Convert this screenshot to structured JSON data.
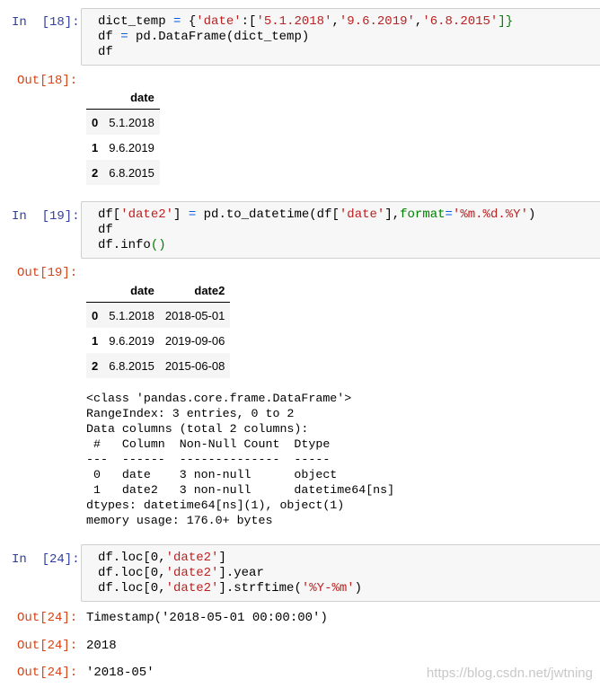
{
  "cells": [
    {
      "in_prompt": "In  [18]:",
      "out_prompt": "Out[18]:",
      "code": [
        [
          {
            "t": "dict_temp ",
            "c": ""
          },
          {
            "t": "=",
            "c": "o"
          },
          {
            "t": " {",
            "c": ""
          },
          {
            "t": "'date'",
            "c": "s"
          },
          {
            "t": ":[",
            "c": ""
          },
          {
            "t": "'5.1.2018'",
            "c": "s"
          },
          {
            "t": ",",
            "c": ""
          },
          {
            "t": "'9.6.2019'",
            "c": "s"
          },
          {
            "t": ",",
            "c": ""
          },
          {
            "t": "'6.8.2015'",
            "c": "s"
          },
          {
            "t": "]}",
            "c": "g"
          }
        ],
        [
          {
            "t": "df ",
            "c": ""
          },
          {
            "t": "=",
            "c": "o"
          },
          {
            "t": " pd.DataFrame(dict_temp)",
            "c": ""
          }
        ],
        [
          {
            "t": "df",
            "c": ""
          }
        ]
      ],
      "table": {
        "columns": [
          "date"
        ],
        "rows": [
          {
            "index": "0",
            "values": [
              "5.1.2018"
            ]
          },
          {
            "index": "1",
            "values": [
              "9.6.2019"
            ]
          },
          {
            "index": "2",
            "values": [
              "6.8.2015"
            ]
          }
        ]
      }
    },
    {
      "in_prompt": "In  [19]:",
      "out_prompt": "Out[19]:",
      "code": [
        [
          {
            "t": "df[",
            "c": ""
          },
          {
            "t": "'date2'",
            "c": "s"
          },
          {
            "t": "] ",
            "c": ""
          },
          {
            "t": "=",
            "c": "o"
          },
          {
            "t": " pd.to_datetime(df[",
            "c": ""
          },
          {
            "t": "'date'",
            "c": "s"
          },
          {
            "t": "],",
            "c": ""
          },
          {
            "t": "format",
            "c": "k"
          },
          {
            "t": "=",
            "c": "o"
          },
          {
            "t": "'%m.%d.%Y'",
            "c": "s"
          },
          {
            "t": ")",
            "c": ""
          }
        ],
        [
          {
            "t": "df",
            "c": ""
          }
        ],
        [
          {
            "t": "df.info",
            "c": ""
          },
          {
            "t": "()",
            "c": "g"
          }
        ]
      ],
      "table": {
        "columns": [
          "date",
          "date2"
        ],
        "rows": [
          {
            "index": "0",
            "values": [
              "5.1.2018",
              "2018-05-01"
            ]
          },
          {
            "index": "1",
            "values": [
              "9.6.2019",
              "2019-09-06"
            ]
          },
          {
            "index": "2",
            "values": [
              "6.8.2015",
              "2015-06-08"
            ]
          }
        ]
      },
      "info_lines": [
        "<class 'pandas.core.frame.DataFrame'>",
        "RangeIndex: 3 entries, 0 to 2",
        "Data columns (total 2 columns):",
        " #   Column  Non-Null Count  Dtype",
        "---  ------  --------------  -----",
        " 0   date    3 non-null      object",
        " 1   date2   3 non-null      datetime64[ns]",
        "dtypes: datetime64[ns](1), object(1)",
        "memory usage: 176.0+ bytes"
      ]
    },
    {
      "in_prompt": "In  [24]:",
      "code": [
        [
          {
            "t": "df.loc[0,",
            "c": ""
          },
          {
            "t": "'date2'",
            "c": "s"
          },
          {
            "t": "]",
            "c": ""
          }
        ],
        [
          {
            "t": "df.loc[0,",
            "c": ""
          },
          {
            "t": "'date2'",
            "c": "s"
          },
          {
            "t": "].year",
            "c": ""
          }
        ],
        [
          {
            "t": "df.loc[0,",
            "c": ""
          },
          {
            "t": "'date2'",
            "c": "s"
          },
          {
            "t": "].strftime(",
            "c": ""
          },
          {
            "t": "'%Y-%m'",
            "c": "s"
          },
          {
            "t": ")",
            "c": ""
          }
        ]
      ],
      "outputs": [
        {
          "prompt": "Out[24]:",
          "value": "Timestamp('2018-05-01 00:00:00')"
        },
        {
          "prompt": "Out[24]:",
          "value": "2018"
        },
        {
          "prompt": "Out[24]:",
          "value": "'2018-05'"
        }
      ]
    }
  ],
  "watermark": "https://blog.csdn.net/jwtning",
  "colors": {
    "in_prompt": "#303f9f",
    "out_prompt": "#d84315",
    "string": "#ba2121",
    "operator": "#055be0",
    "keyword": "#008000",
    "input_bg": "#f7f7f7"
  }
}
